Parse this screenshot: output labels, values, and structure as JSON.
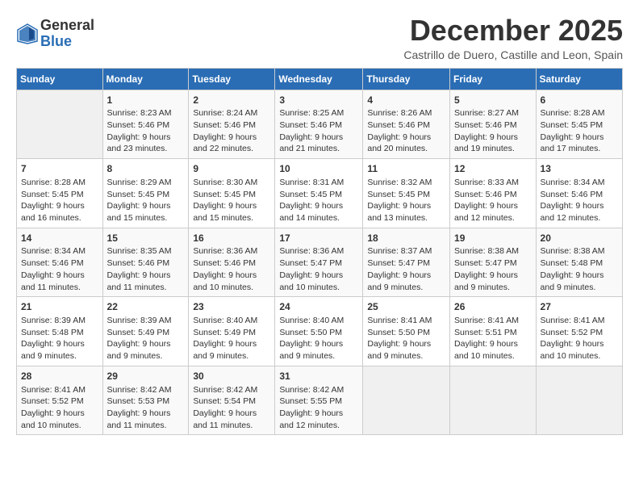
{
  "logo": {
    "general": "General",
    "blue": "Blue"
  },
  "title": "December 2025",
  "subtitle": "Castrillo de Duero, Castille and Leon, Spain",
  "days_header": [
    "Sunday",
    "Monday",
    "Tuesday",
    "Wednesday",
    "Thursday",
    "Friday",
    "Saturday"
  ],
  "weeks": [
    [
      {
        "num": "",
        "lines": []
      },
      {
        "num": "1",
        "lines": [
          "Sunrise: 8:23 AM",
          "Sunset: 5:46 PM",
          "Daylight: 9 hours",
          "and 23 minutes."
        ]
      },
      {
        "num": "2",
        "lines": [
          "Sunrise: 8:24 AM",
          "Sunset: 5:46 PM",
          "Daylight: 9 hours",
          "and 22 minutes."
        ]
      },
      {
        "num": "3",
        "lines": [
          "Sunrise: 8:25 AM",
          "Sunset: 5:46 PM",
          "Daylight: 9 hours",
          "and 21 minutes."
        ]
      },
      {
        "num": "4",
        "lines": [
          "Sunrise: 8:26 AM",
          "Sunset: 5:46 PM",
          "Daylight: 9 hours",
          "and 20 minutes."
        ]
      },
      {
        "num": "5",
        "lines": [
          "Sunrise: 8:27 AM",
          "Sunset: 5:46 PM",
          "Daylight: 9 hours",
          "and 19 minutes."
        ]
      },
      {
        "num": "6",
        "lines": [
          "Sunrise: 8:28 AM",
          "Sunset: 5:45 PM",
          "Daylight: 9 hours",
          "and 17 minutes."
        ]
      }
    ],
    [
      {
        "num": "7",
        "lines": [
          "Sunrise: 8:28 AM",
          "Sunset: 5:45 PM",
          "Daylight: 9 hours",
          "and 16 minutes."
        ]
      },
      {
        "num": "8",
        "lines": [
          "Sunrise: 8:29 AM",
          "Sunset: 5:45 PM",
          "Daylight: 9 hours",
          "and 15 minutes."
        ]
      },
      {
        "num": "9",
        "lines": [
          "Sunrise: 8:30 AM",
          "Sunset: 5:45 PM",
          "Daylight: 9 hours",
          "and 15 minutes."
        ]
      },
      {
        "num": "10",
        "lines": [
          "Sunrise: 8:31 AM",
          "Sunset: 5:45 PM",
          "Daylight: 9 hours",
          "and 14 minutes."
        ]
      },
      {
        "num": "11",
        "lines": [
          "Sunrise: 8:32 AM",
          "Sunset: 5:45 PM",
          "Daylight: 9 hours",
          "and 13 minutes."
        ]
      },
      {
        "num": "12",
        "lines": [
          "Sunrise: 8:33 AM",
          "Sunset: 5:46 PM",
          "Daylight: 9 hours",
          "and 12 minutes."
        ]
      },
      {
        "num": "13",
        "lines": [
          "Sunrise: 8:34 AM",
          "Sunset: 5:46 PM",
          "Daylight: 9 hours",
          "and 12 minutes."
        ]
      }
    ],
    [
      {
        "num": "14",
        "lines": [
          "Sunrise: 8:34 AM",
          "Sunset: 5:46 PM",
          "Daylight: 9 hours",
          "and 11 minutes."
        ]
      },
      {
        "num": "15",
        "lines": [
          "Sunrise: 8:35 AM",
          "Sunset: 5:46 PM",
          "Daylight: 9 hours",
          "and 11 minutes."
        ]
      },
      {
        "num": "16",
        "lines": [
          "Sunrise: 8:36 AM",
          "Sunset: 5:46 PM",
          "Daylight: 9 hours",
          "and 10 minutes."
        ]
      },
      {
        "num": "17",
        "lines": [
          "Sunrise: 8:36 AM",
          "Sunset: 5:47 PM",
          "Daylight: 9 hours",
          "and 10 minutes."
        ]
      },
      {
        "num": "18",
        "lines": [
          "Sunrise: 8:37 AM",
          "Sunset: 5:47 PM",
          "Daylight: 9 hours",
          "and 9 minutes."
        ]
      },
      {
        "num": "19",
        "lines": [
          "Sunrise: 8:38 AM",
          "Sunset: 5:47 PM",
          "Daylight: 9 hours",
          "and 9 minutes."
        ]
      },
      {
        "num": "20",
        "lines": [
          "Sunrise: 8:38 AM",
          "Sunset: 5:48 PM",
          "Daylight: 9 hours",
          "and 9 minutes."
        ]
      }
    ],
    [
      {
        "num": "21",
        "lines": [
          "Sunrise: 8:39 AM",
          "Sunset: 5:48 PM",
          "Daylight: 9 hours",
          "and 9 minutes."
        ]
      },
      {
        "num": "22",
        "lines": [
          "Sunrise: 8:39 AM",
          "Sunset: 5:49 PM",
          "Daylight: 9 hours",
          "and 9 minutes."
        ]
      },
      {
        "num": "23",
        "lines": [
          "Sunrise: 8:40 AM",
          "Sunset: 5:49 PM",
          "Daylight: 9 hours",
          "and 9 minutes."
        ]
      },
      {
        "num": "24",
        "lines": [
          "Sunrise: 8:40 AM",
          "Sunset: 5:50 PM",
          "Daylight: 9 hours",
          "and 9 minutes."
        ]
      },
      {
        "num": "25",
        "lines": [
          "Sunrise: 8:41 AM",
          "Sunset: 5:50 PM",
          "Daylight: 9 hours",
          "and 9 minutes."
        ]
      },
      {
        "num": "26",
        "lines": [
          "Sunrise: 8:41 AM",
          "Sunset: 5:51 PM",
          "Daylight: 9 hours",
          "and 10 minutes."
        ]
      },
      {
        "num": "27",
        "lines": [
          "Sunrise: 8:41 AM",
          "Sunset: 5:52 PM",
          "Daylight: 9 hours",
          "and 10 minutes."
        ]
      }
    ],
    [
      {
        "num": "28",
        "lines": [
          "Sunrise: 8:41 AM",
          "Sunset: 5:52 PM",
          "Daylight: 9 hours",
          "and 10 minutes."
        ]
      },
      {
        "num": "29",
        "lines": [
          "Sunrise: 8:42 AM",
          "Sunset: 5:53 PM",
          "Daylight: 9 hours",
          "and 11 minutes."
        ]
      },
      {
        "num": "30",
        "lines": [
          "Sunrise: 8:42 AM",
          "Sunset: 5:54 PM",
          "Daylight: 9 hours",
          "and 11 minutes."
        ]
      },
      {
        "num": "31",
        "lines": [
          "Sunrise: 8:42 AM",
          "Sunset: 5:55 PM",
          "Daylight: 9 hours",
          "and 12 minutes."
        ]
      },
      {
        "num": "",
        "lines": []
      },
      {
        "num": "",
        "lines": []
      },
      {
        "num": "",
        "lines": []
      }
    ]
  ]
}
